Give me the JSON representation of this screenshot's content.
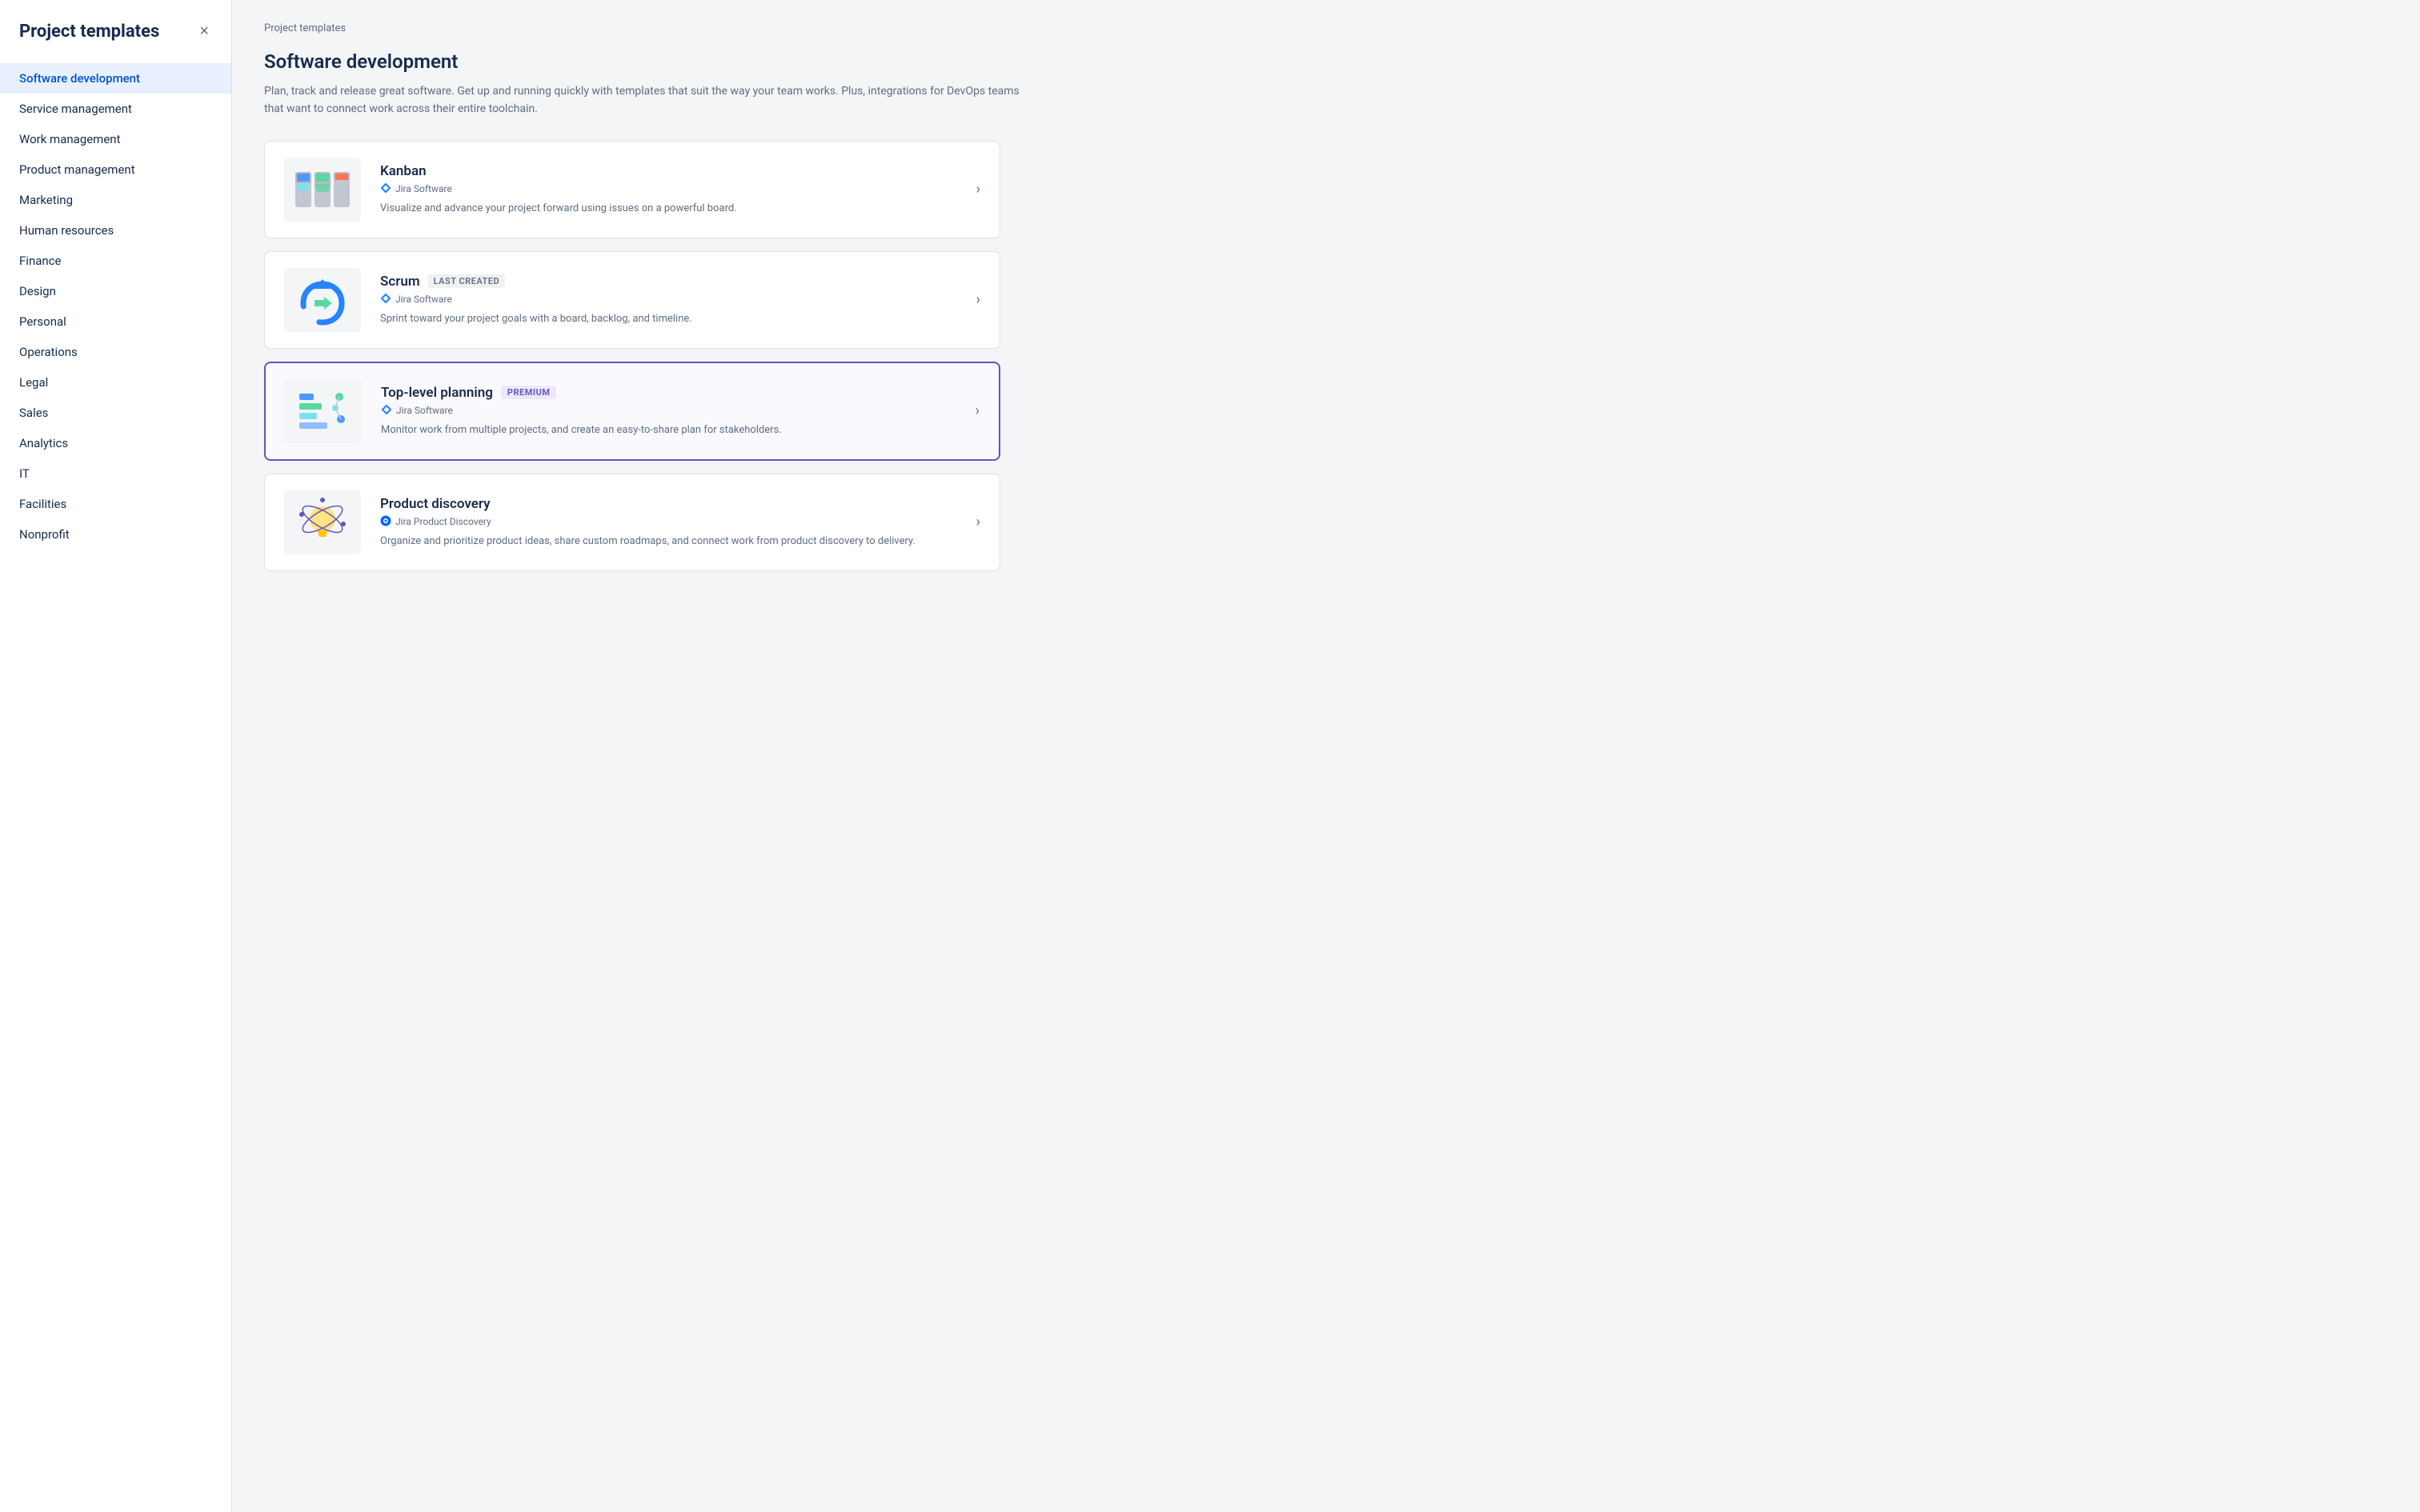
{
  "sidebar": {
    "title": "Project templates",
    "close_label": "×",
    "items": [
      {
        "id": "software-development",
        "label": "Software development",
        "active": true
      },
      {
        "id": "service-management",
        "label": "Service management",
        "active": false
      },
      {
        "id": "work-management",
        "label": "Work management",
        "active": false
      },
      {
        "id": "product-management",
        "label": "Product management",
        "active": false
      },
      {
        "id": "marketing",
        "label": "Marketing",
        "active": false
      },
      {
        "id": "human-resources",
        "label": "Human resources",
        "active": false
      },
      {
        "id": "finance",
        "label": "Finance",
        "active": false
      },
      {
        "id": "design",
        "label": "Design",
        "active": false
      },
      {
        "id": "personal",
        "label": "Personal",
        "active": false
      },
      {
        "id": "operations",
        "label": "Operations",
        "active": false
      },
      {
        "id": "legal",
        "label": "Legal",
        "active": false
      },
      {
        "id": "sales",
        "label": "Sales",
        "active": false
      },
      {
        "id": "analytics",
        "label": "Analytics",
        "active": false
      },
      {
        "id": "it",
        "label": "IT",
        "active": false
      },
      {
        "id": "facilities",
        "label": "Facilities",
        "active": false
      },
      {
        "id": "nonprofit",
        "label": "Nonprofit",
        "active": false
      }
    ]
  },
  "main": {
    "breadcrumb": "Project templates",
    "section_title": "Software development",
    "section_description": "Plan, track and release great software. Get up and running quickly with templates that suit the way your team works. Plus, integrations for DevOps teams that want to connect work across their entire toolchain.",
    "templates": [
      {
        "id": "kanban",
        "name": "Kanban",
        "badge": "",
        "source": "Jira Software",
        "source_icon": "jira-software",
        "description": "Visualize and advance your project forward using issues on a powerful board.",
        "highlighted": false
      },
      {
        "id": "scrum",
        "name": "Scrum",
        "badge": "LAST CREATED",
        "source": "Jira Software",
        "source_icon": "jira-software",
        "description": "Sprint toward your project goals with a board, backlog, and timeline.",
        "highlighted": false
      },
      {
        "id": "top-level-planning",
        "name": "Top-level planning",
        "badge": "PREMIUM",
        "source": "Jira Software",
        "source_icon": "jira-software",
        "description": "Monitor work from multiple projects, and create an easy-to-share plan for stakeholders.",
        "highlighted": true
      },
      {
        "id": "product-discovery",
        "name": "Product discovery",
        "badge": "",
        "source": "Jira Product Discovery",
        "source_icon": "jira-product-discovery",
        "description": "Organize and prioritize product ideas, share custom roadmaps, and connect work from product discovery to delivery.",
        "highlighted": false
      }
    ]
  },
  "icons": {
    "chevron_right": "›",
    "close": "×"
  }
}
